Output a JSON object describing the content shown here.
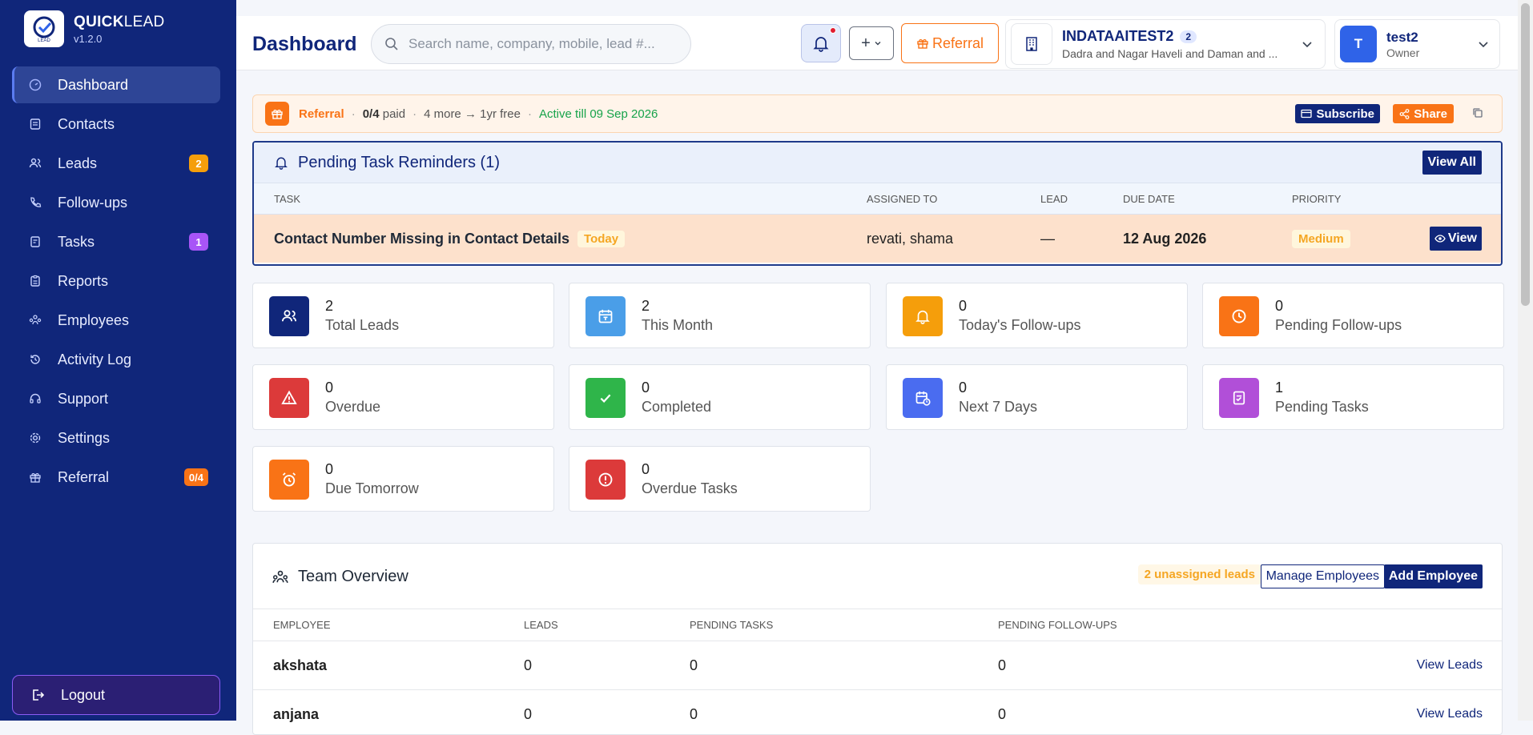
{
  "brand": {
    "name_bold": "QUICK",
    "name_rest": "LEAD",
    "version": "v1.2.0"
  },
  "sidebar": {
    "items": [
      {
        "label": "Dashboard",
        "icon": "dashboard-icon"
      },
      {
        "label": "Contacts",
        "icon": "contacts-icon"
      },
      {
        "label": "Leads",
        "icon": "leads-icon",
        "badge": "2",
        "badge_color": "#f59e0b"
      },
      {
        "label": "Follow-ups",
        "icon": "phone-icon"
      },
      {
        "label": "Tasks",
        "icon": "tasks-icon",
        "badge": "1",
        "badge_color": "#a855f7"
      },
      {
        "label": "Reports",
        "icon": "reports-icon"
      },
      {
        "label": "Employees",
        "icon": "employees-icon"
      },
      {
        "label": "Activity Log",
        "icon": "history-icon"
      },
      {
        "label": "Support",
        "icon": "headset-icon"
      },
      {
        "label": "Settings",
        "icon": "gear-icon"
      },
      {
        "label": "Referral",
        "icon": "gift-icon",
        "badge": "0/4",
        "badge_color": "#f97316"
      }
    ],
    "logout": "Logout"
  },
  "header": {
    "title": "Dashboard",
    "search_placeholder": "Search name, company, mobile, lead #...",
    "plus": "+",
    "referral": "Referral",
    "company_name": "INDATAAITEST2",
    "company_count": "2",
    "company_address": "Dadra and Nagar Haveli and Daman and ...",
    "user_initial": "T",
    "user_name": "test2",
    "user_role": "Owner"
  },
  "referral_bar": {
    "label": "Referral",
    "paid_count": "0/4",
    "paid_text": "paid",
    "more": "4 more → 1yr free",
    "active": "Active till 09 Sep 2026",
    "subscribe": "Subscribe",
    "share": "Share"
  },
  "reminders": {
    "title": "Pending Task Reminders (1)",
    "view_all": "View All",
    "columns": [
      "TASK",
      "ASSIGNED TO",
      "LEAD",
      "DUE DATE",
      "PRIORITY"
    ],
    "rows": [
      {
        "task": "Contact Number Missing in Contact Details",
        "tag": "Today",
        "assigned": "revati, shama",
        "lead": "—",
        "due": "12 Aug 2026",
        "priority": "Medium",
        "view": "View"
      }
    ]
  },
  "stats": [
    {
      "value": "2",
      "label": "Total Leads",
      "color": "#10267a",
      "icon": "users-icon"
    },
    {
      "value": "2",
      "label": "This Month",
      "color": "#4a9ee8",
      "icon": "calendar-icon"
    },
    {
      "value": "0",
      "label": "Today's Follow-ups",
      "color": "#f59e0b",
      "icon": "bell-icon"
    },
    {
      "value": "0",
      "label": "Pending Follow-ups",
      "color": "#f97316",
      "icon": "clock-icon"
    },
    {
      "value": "0",
      "label": "Overdue",
      "color": "#dc3a3a",
      "icon": "warning-icon"
    },
    {
      "value": "0",
      "label": "Completed",
      "color": "#2fb54a",
      "icon": "check-icon"
    },
    {
      "value": "0",
      "label": "Next 7 Days",
      "color": "#4a6cf0",
      "icon": "calendar-clock-icon"
    },
    {
      "value": "1",
      "label": "Pending Tasks",
      "color": "#b14fd8",
      "icon": "task-icon"
    },
    {
      "value": "0",
      "label": "Due Tomorrow",
      "color": "#f97316",
      "icon": "alarm-icon"
    },
    {
      "value": "0",
      "label": "Overdue Tasks",
      "color": "#dc3a3a",
      "icon": "alert-circle-icon"
    }
  ],
  "team": {
    "title": "Team Overview",
    "unassigned": "2 unassigned leads",
    "manage": "Manage Employees",
    "add": "Add Employee",
    "columns": [
      "EMPLOYEE",
      "LEADS",
      "PENDING TASKS",
      "PENDING FOLLOW-UPS"
    ],
    "rows": [
      {
        "employee": "akshata",
        "leads": "0",
        "tasks": "0",
        "followups": "0",
        "action": "View Leads"
      },
      {
        "employee": "anjana",
        "leads": "0",
        "tasks": "0",
        "followups": "0",
        "action": "View Leads"
      }
    ]
  }
}
